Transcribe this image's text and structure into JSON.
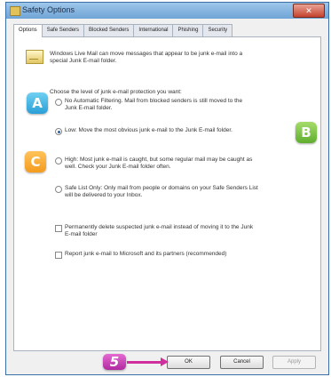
{
  "window": {
    "title": "Safety Options",
    "close_label": "✕"
  },
  "tabs": [
    {
      "label": "Options",
      "active": true
    },
    {
      "label": "Safe Senders"
    },
    {
      "label": "Blocked Senders"
    },
    {
      "label": "International"
    },
    {
      "label": "Phishing"
    },
    {
      "label": "Security"
    }
  ],
  "intro": {
    "line1": "Windows Live Mail can move messages that appear to be junk e-mail into a",
    "line2": "special Junk E-mail folder."
  },
  "level": {
    "heading": "Choose the level of junk e-mail protection you want:",
    "options": [
      {
        "line1": "No Automatic Filtering. Mail from blocked senders is still moved to the",
        "line2": "Junk E-mail folder.",
        "selected": false
      },
      {
        "line1": "Low: Move the most obvious junk e-mail to the Junk E-mail folder.",
        "line2": "",
        "selected": true
      },
      {
        "line1": "High: Most junk e-mail is caught, but some regular mail may be caught as",
        "line2": "well. Check your Junk E-mail folder often.",
        "selected": false
      },
      {
        "line1": "Safe List Only: Only mail from people or domains on your Safe Senders List",
        "line2": "will be delivered to your Inbox.",
        "selected": false
      }
    ]
  },
  "checks": [
    {
      "line1": "Permanently delete suspected junk e-mail instead of moving it to the Junk",
      "line2": "E-mail folder",
      "checked": false
    },
    {
      "line1": "Report junk e-mail to Microsoft and its partners (recommended)",
      "line2": "",
      "checked": false
    }
  ],
  "buttons": {
    "ok": "OK",
    "cancel": "Cancel",
    "apply": "Apply"
  },
  "callouts": {
    "a": "A",
    "b": "B",
    "c": "C",
    "step": "5"
  },
  "colors": {
    "callout_a": "#2a9fd6",
    "callout_b": "#5fae2e",
    "callout_c": "#f39b1e",
    "callout_step": "#b02aa0",
    "arrow": "#d0309e"
  }
}
